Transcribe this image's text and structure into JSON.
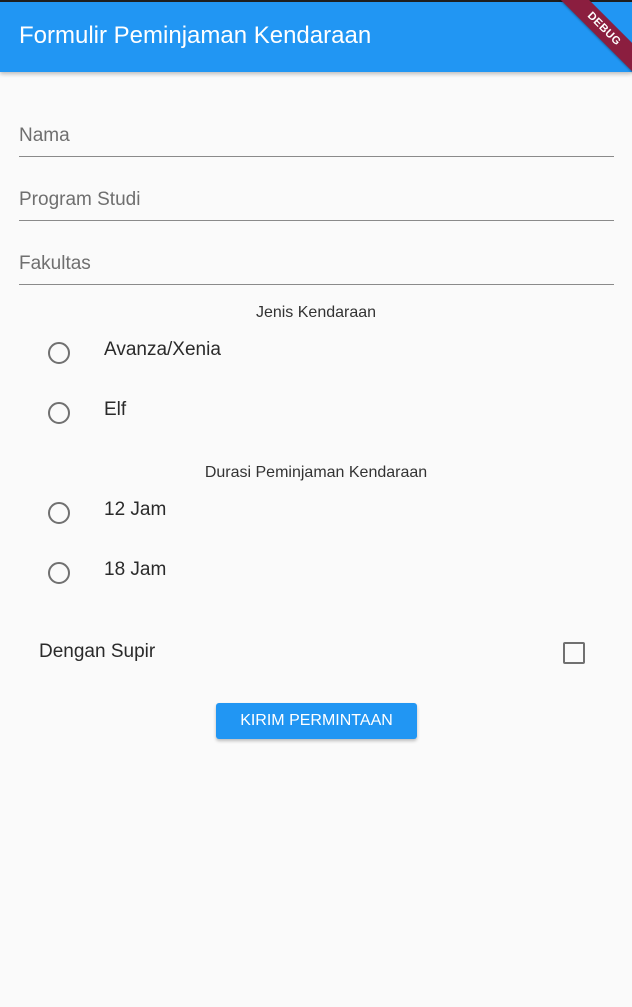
{
  "appbar": {
    "title": "Formulir Peminjaman Kendaraan",
    "debug_banner": "DEBUG",
    "color": "#2196f3"
  },
  "form": {
    "fields": [
      {
        "placeholder": "Nama",
        "value": ""
      },
      {
        "placeholder": "Program Studi",
        "value": ""
      },
      {
        "placeholder": "Fakultas",
        "value": ""
      }
    ],
    "vehicle_type": {
      "label": "Jenis Kendaraan",
      "options": [
        "Avanza/Xenia",
        "Elf"
      ],
      "selected": null
    },
    "duration": {
      "label": "Durasi Peminjaman Kendaraan",
      "options": [
        "12 Jam",
        "18 Jam"
      ],
      "selected": null
    },
    "driver": {
      "label": "Dengan Supir",
      "checked": false
    },
    "submit_label": "KIRIM PERMINTAAN"
  },
  "icons": {
    "radio": "radio-unselected-icon",
    "checkbox": "checkbox-unchecked-icon"
  }
}
